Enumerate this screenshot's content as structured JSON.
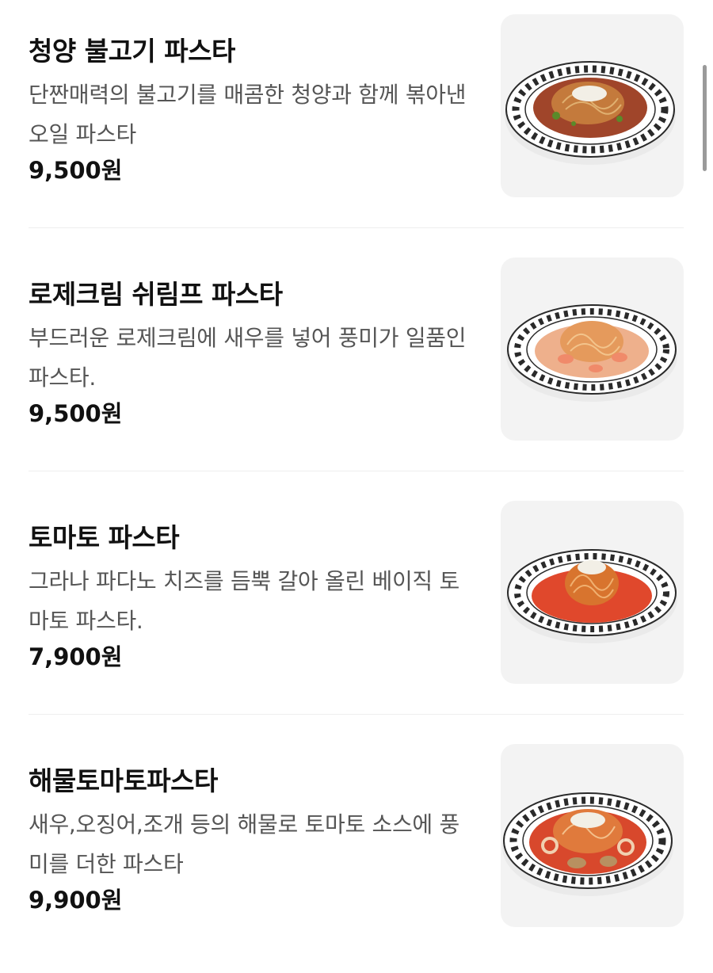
{
  "menu": {
    "items": [
      {
        "name": "청양 불고기 파스타",
        "description": "단짠매력의 불고기를 매콤한 청양과 함께 볶아낸 오일 파스타",
        "price": "9,500원",
        "sauce_color": "#a0452a",
        "noodle_color": "#c47a3c"
      },
      {
        "name": "로제크림 쉬림프 파스타",
        "description": "부드러운 로제크림에 새우를 넣어 풍미가 일품인 파스타.",
        "price": "9,500원",
        "sauce_color": "#eeb08c",
        "noodle_color": "#e59a5c"
      },
      {
        "name": "토마토 파스타",
        "description": "그라나 파다노 치즈를 듬뿍 갈아 올린 베이직 토마토 파스타.",
        "price": "7,900원",
        "sauce_color": "#e0482c",
        "noodle_color": "#d8742e"
      },
      {
        "name": "해물토마토파스타",
        "description": "새우,오징어,조개 등의 해물로 토마토 소스에 풍미를 더한 파스타",
        "price": "9,900원",
        "sauce_color": "#d8482c",
        "noodle_color": "#e07a3c"
      }
    ]
  }
}
